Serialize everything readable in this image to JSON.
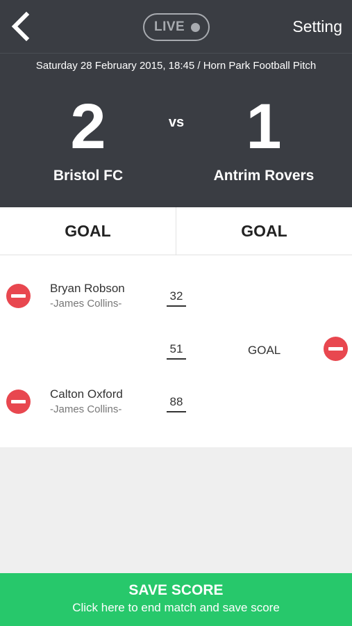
{
  "topbar": {
    "back_icon": "chevron-left-icon",
    "live_label": "LIVE",
    "setting_label": "Setting"
  },
  "match": {
    "info": "Saturday 28 February 2015, 18:45 / Horn Park Football Pitch",
    "home": {
      "score": "2",
      "name": "Bristol FC"
    },
    "vs": "vs",
    "away": {
      "score": "1",
      "name": "Antrim Rovers"
    }
  },
  "actions": {
    "home_goal": "GOAL",
    "away_goal": "GOAL"
  },
  "events": [
    {
      "side": "home",
      "player": "Bryan Robson",
      "assist": "-James Collins-",
      "minute": "32"
    },
    {
      "side": "away",
      "label": "GOAL",
      "minute": "51"
    },
    {
      "side": "home",
      "player": "Calton Oxford",
      "assist": "-James Collins-",
      "minute": "88"
    }
  ],
  "save": {
    "title": "SAVE SCORE",
    "subtitle": "Click here to end match and save score"
  },
  "colors": {
    "header_bg": "#3a3d43",
    "remove_red": "#e8474f",
    "save_green": "#27c86b"
  }
}
